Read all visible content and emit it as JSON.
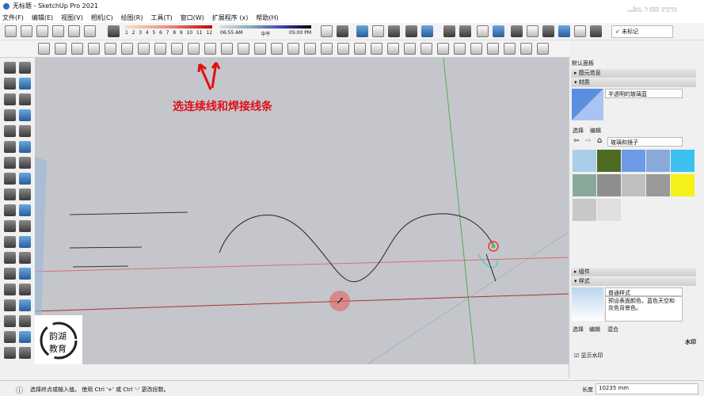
{
  "window": {
    "title": "无标题 - SketchUp Pro 2021"
  },
  "menu": [
    "文件(F)",
    "编辑(E)",
    "视图(V)",
    "相机(C)",
    "绘图(R)",
    "工具(T)",
    "窗口(W)",
    "扩展程序 (x)",
    "帮助(H)"
  ],
  "shadow": {
    "months": [
      "1",
      "2",
      "3",
      "4",
      "5",
      "6",
      "7",
      "8",
      "9",
      "10",
      "11",
      "12"
    ],
    "time_start": "06:55 AM",
    "time_mid": "中午",
    "time_end": "05:00 PM"
  },
  "tag_select": "✓ 未标记",
  "watermark": "虎课网",
  "annotation": "选连续线和焊接线条",
  "logo_text": "韵湖教育",
  "panel": {
    "title": "默认面板",
    "entity_info": "▸ 图元信息",
    "materials": "▾ 材质",
    "material_name": "半透明的玻璃蓝",
    "tab_select": "选择",
    "tab_edit": "编辑",
    "library": "玻璃和镜子",
    "swatch_colors": [
      "#a9cfe8",
      "#4d6b22",
      "#6b9be6",
      "#8aa8d8",
      "#3cc0ee",
      "#8aa89a",
      "#8e8e8e",
      "#bfbfbf",
      "#9a9a9a",
      "#f3f01a",
      "#c8c8c8",
      "#e0e0e0"
    ],
    "components": "▸ 组件",
    "styles": "▾ 样式",
    "style_name": "普通样式",
    "style_desc": "预设表面颜色，蓝色天空和灰色背景色。",
    "style_tabs": [
      "选择",
      "编辑",
      "混合"
    ],
    "watermark_label": "水印",
    "show_watermark": "显示水印"
  },
  "status": {
    "message": "选择终点或输入值。 使用 Ctrl '+' 或 Ctrl '-' 更改段数。",
    "length_label": "长度",
    "length_value": "10235 mm"
  }
}
